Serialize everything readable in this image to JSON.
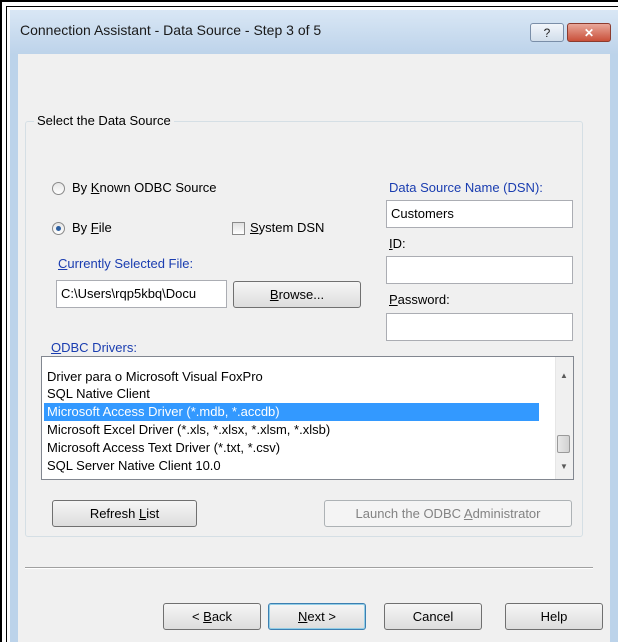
{
  "window": {
    "title": "Connection Assistant - Data Source - Step 3 of 5",
    "help_glyph": "?",
    "close_glyph": "✕"
  },
  "source_group": {
    "label": "Select the Data Source",
    "by_known_odbc": {
      "label_pre": "By ",
      "label_ul": "K",
      "label_post": "nown ODBC Source",
      "selected": false
    },
    "by_file": {
      "label_pre": "By ",
      "label_ul": "F",
      "label_post": "ile",
      "selected": true
    },
    "system_dsn": {
      "label_ul": "S",
      "label_post": "ystem DSN",
      "checked": false
    },
    "selected_file": {
      "label_ul": "C",
      "label_post": "urrently Selected File:",
      "value": "C:\\Users\\rqp5kbq\\Docu"
    },
    "browse": {
      "label_ul": "B",
      "label_post": "rowse..."
    },
    "dsn": {
      "label": "Data Source Name (DSN):",
      "value": "Customers"
    },
    "id": {
      "label_ul": "I",
      "label_post": "D:",
      "value": ""
    },
    "password": {
      "label_ul": "P",
      "label_post": "assword:",
      "value": ""
    },
    "odbc_drivers": {
      "label_ul": "O",
      "label_post": "DBC Drivers:",
      "items": [
        "Driver para o Microsoft Visual FoxPro",
        "SQL Native Client",
        "Microsoft Access Driver (*.mdb, *.accdb)",
        "Microsoft Excel Driver (*.xls, *.xlsx, *.xlsm, *.xlsb)",
        "Microsoft Access Text Driver (*.txt, *.csv)",
        "SQL Server Native Client 10.0"
      ],
      "selected_index": 2
    },
    "refresh": {
      "label_pre": "Refresh ",
      "label_ul": "L",
      "label_post": "ist"
    },
    "launch_admin": {
      "label_pre": "Launch the ODBC ",
      "label_ul": "A",
      "label_post": "dministrator",
      "enabled": false
    }
  },
  "footer": {
    "back": {
      "label_pre": "< ",
      "label_ul": "B",
      "label_post": "ack"
    },
    "next": {
      "label_ul": "N",
      "label_post": "ext >"
    },
    "cancel": "Cancel",
    "help": "Help"
  },
  "icons": {
    "scroll_up": "▲",
    "scroll_down": "▼"
  }
}
